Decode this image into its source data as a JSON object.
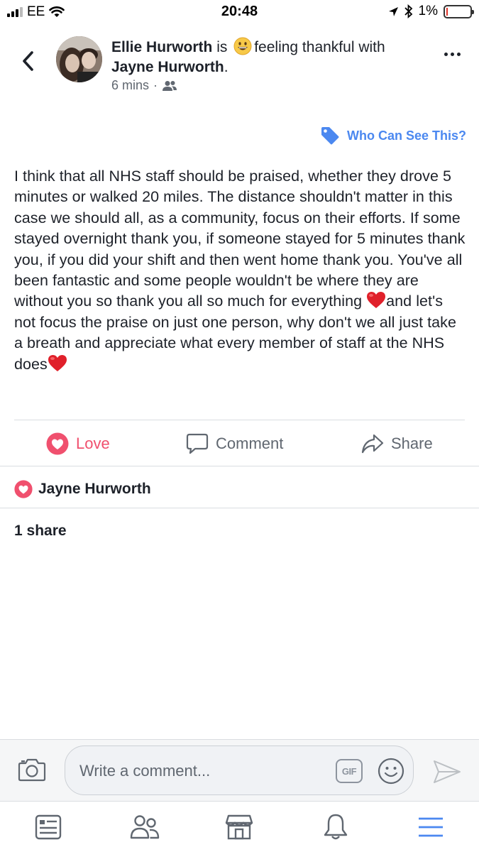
{
  "status_bar": {
    "carrier": "EE",
    "time": "20:48",
    "battery": "1%"
  },
  "post": {
    "author": "Ellie Hurworth",
    "connector": "is",
    "feeling": "feeling thankful with",
    "with_name": "Jayne Hurworth",
    "with_suffix": ".",
    "time_ago": "6 mins",
    "meta_separator": "·",
    "privacy_link": "Who Can See This?",
    "body_part1": "I think that all NHS staff should be praised, whether they drove 5 minutes or walked 20 miles. The distance shouldn't matter in this case we should all, as a community, focus on their efforts. If some stayed overnight thank you, if someone stayed for 5 minutes thank you, if you did your shift and then went home thank you. You've all been fantastic and some people wouldn't be where they are without you so thank you all so much for everything ",
    "body_part2": "and let's not focus the praise on just one person, why don't we all just take a breath and appreciate what every member of staff at the NHS does"
  },
  "actions": {
    "love": "Love",
    "comment": "Comment",
    "share": "Share"
  },
  "reactions": {
    "reactor": "Jayne Hurworth"
  },
  "shares_text": "1 share",
  "composer": {
    "placeholder": "Write a comment...",
    "gif_label": "GIF"
  },
  "colors": {
    "love": "#f0506e",
    "link": "#4b88f0",
    "text": "#1d2129",
    "muted": "#606770"
  }
}
